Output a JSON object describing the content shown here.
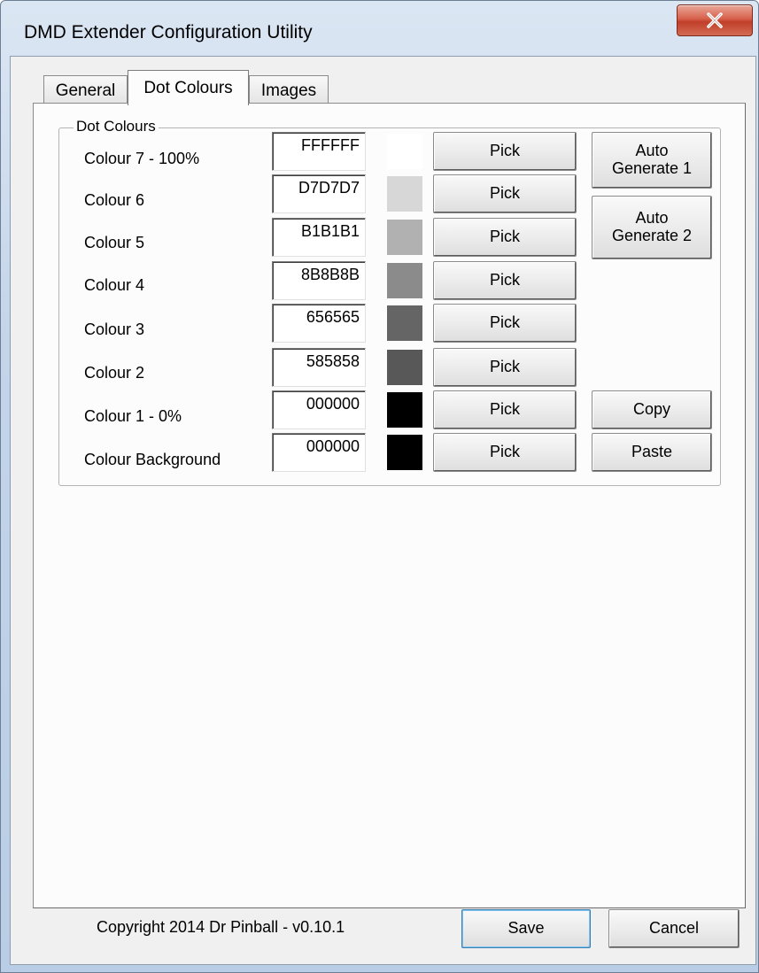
{
  "window": {
    "title": "DMD Extender Configuration Utility"
  },
  "tabs": [
    {
      "label": "General"
    },
    {
      "label": "Dot Colours"
    },
    {
      "label": "Images"
    }
  ],
  "group": {
    "label": "Dot Colours",
    "rows": [
      {
        "label": "Colour 7 - 100%",
        "hex": "FFFFFF",
        "color": "#FFFFFF",
        "pick": "Pick"
      },
      {
        "label": "Colour 6",
        "hex": "D7D7D7",
        "color": "#D7D7D7",
        "pick": "Pick"
      },
      {
        "label": "Colour 5",
        "hex": "B1B1B1",
        "color": "#B1B1B1",
        "pick": "Pick"
      },
      {
        "label": "Colour 4",
        "hex": "8B8B8B",
        "color": "#8B8B8B",
        "pick": "Pick"
      },
      {
        "label": "Colour 3",
        "hex": "656565",
        "color": "#656565",
        "pick": "Pick"
      },
      {
        "label": "Colour 2",
        "hex": "585858",
        "color": "#585858",
        "pick": "Pick"
      },
      {
        "label": "Colour 1 - 0%",
        "hex": "000000",
        "color": "#000000",
        "pick": "Pick"
      },
      {
        "label": "Colour Background",
        "hex": "000000",
        "color": "#000000",
        "pick": "Pick"
      }
    ],
    "auto_generate_1": {
      "line1": "Auto",
      "line2": "Generate 1"
    },
    "auto_generate_2": {
      "line1": "Auto",
      "line2": "Generate 2"
    },
    "copy_label": "Copy",
    "paste_label": "Paste"
  },
  "footer": {
    "copyright": "Copyright 2014 Dr Pinball - v0.10.1",
    "save_label": "Save",
    "cancel_label": "Cancel"
  }
}
